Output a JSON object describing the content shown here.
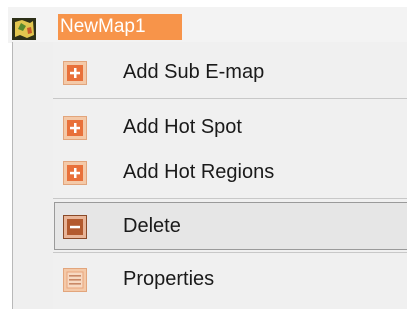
{
  "tree": {
    "node_label": "NewMap1",
    "node_icon": "map-icon"
  },
  "context_menu": {
    "items": [
      {
        "label": "Add Sub E-map",
        "icon": "plus-icon"
      },
      {
        "label": "Add Hot Spot",
        "icon": "plus-icon"
      },
      {
        "label": "Add Hot Regions",
        "icon": "plus-icon"
      },
      {
        "label": "Delete",
        "icon": "minus-icon"
      },
      {
        "label": "Properties",
        "icon": "list-icon"
      }
    ],
    "highlighted_item": "Delete"
  },
  "colors": {
    "selection_orange": "#f7944a",
    "icon_orange": "#e8703a",
    "icon_bg": "#f4c9a8",
    "delete_icon": "#b35a2e"
  }
}
